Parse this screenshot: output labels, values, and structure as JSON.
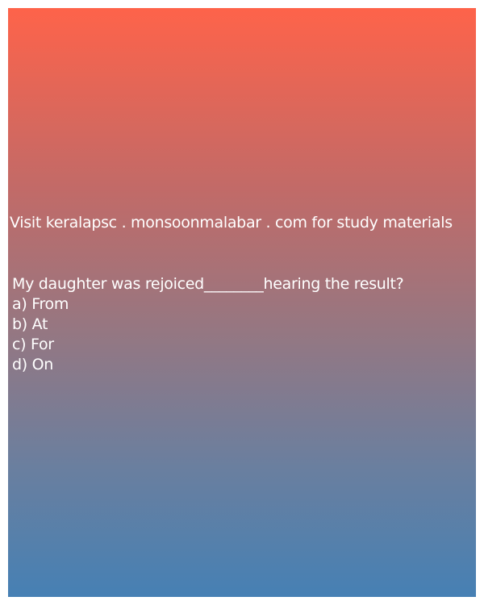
{
  "card": {
    "colors": {
      "gradient_top": "#fe634a",
      "gradient_bottom": "#4680b4",
      "text": "#ffffff"
    },
    "visit_text": "Visit keralapsc . monsoonmalabar . com for study materials",
    "question": "My daughter was rejoiced________hearing the result?",
    "options": [
      "a) From",
      "b) At",
      "c) For",
      "d) On"
    ]
  }
}
